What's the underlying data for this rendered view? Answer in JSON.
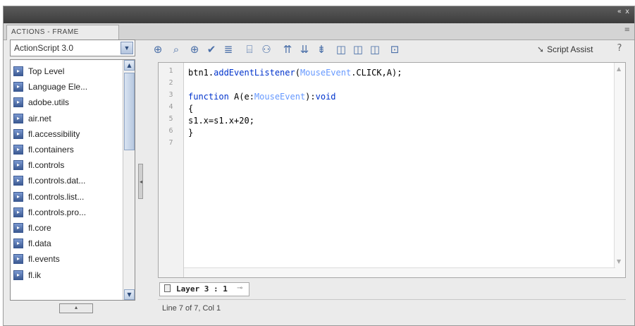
{
  "panel": {
    "tab_title": "ACTIONS - FRAME",
    "window_controls": "« x",
    "menu_glyph": "≡"
  },
  "language_select": {
    "value": "ActionScript 3.0"
  },
  "library": {
    "items": [
      {
        "label": "Top Level"
      },
      {
        "label": "Language Ele..."
      },
      {
        "label": "adobe.utils"
      },
      {
        "label": "air.net"
      },
      {
        "label": "fl.accessibility"
      },
      {
        "label": "fl.containers"
      },
      {
        "label": "fl.controls"
      },
      {
        "label": "fl.controls.dat..."
      },
      {
        "label": "fl.controls.list..."
      },
      {
        "label": "fl.controls.pro..."
      },
      {
        "label": "fl.core"
      },
      {
        "label": "fl.data"
      },
      {
        "label": "fl.events"
      },
      {
        "label": "fl.ik"
      }
    ]
  },
  "toolbar": {
    "icons": [
      "add-statement-icon",
      "find-icon",
      "insert-target-path-icon",
      "check-syntax-icon",
      "auto-format-icon",
      "code-hint-icon",
      "debug-options-icon",
      "collapse-between-braces-icon",
      "collapse-selection-icon",
      "expand-all-icon",
      "apply-block-comment-icon",
      "apply-line-comment-icon",
      "remove-comment-icon",
      "show-hide-toolbox-icon",
      "code-snippets-icon"
    ],
    "script_assist_label": "Script Assist",
    "help_glyph": "?"
  },
  "editor": {
    "line_numbers": [
      "1",
      "2",
      "3",
      "4",
      "5",
      "6",
      "7"
    ],
    "lines": [
      {
        "t1": "btn1.",
        "t2": "addEventListener",
        "t3": "(",
        "t4": "MouseEvent",
        "t5": ".CLICK,A);"
      },
      {
        "text": ""
      },
      {
        "k1": "function",
        "t1": " A(e:",
        "t2": "MouseEvent",
        "t3": "):",
        "k2": "void"
      },
      {
        "text": "{"
      },
      {
        "text": "s1.x=s1.x+20;"
      },
      {
        "text": "}"
      },
      {
        "text": ""
      }
    ]
  },
  "layer_tab": {
    "label": "Layer 3 : 1"
  },
  "status": {
    "text": "Line 7 of 7, Col 1"
  }
}
